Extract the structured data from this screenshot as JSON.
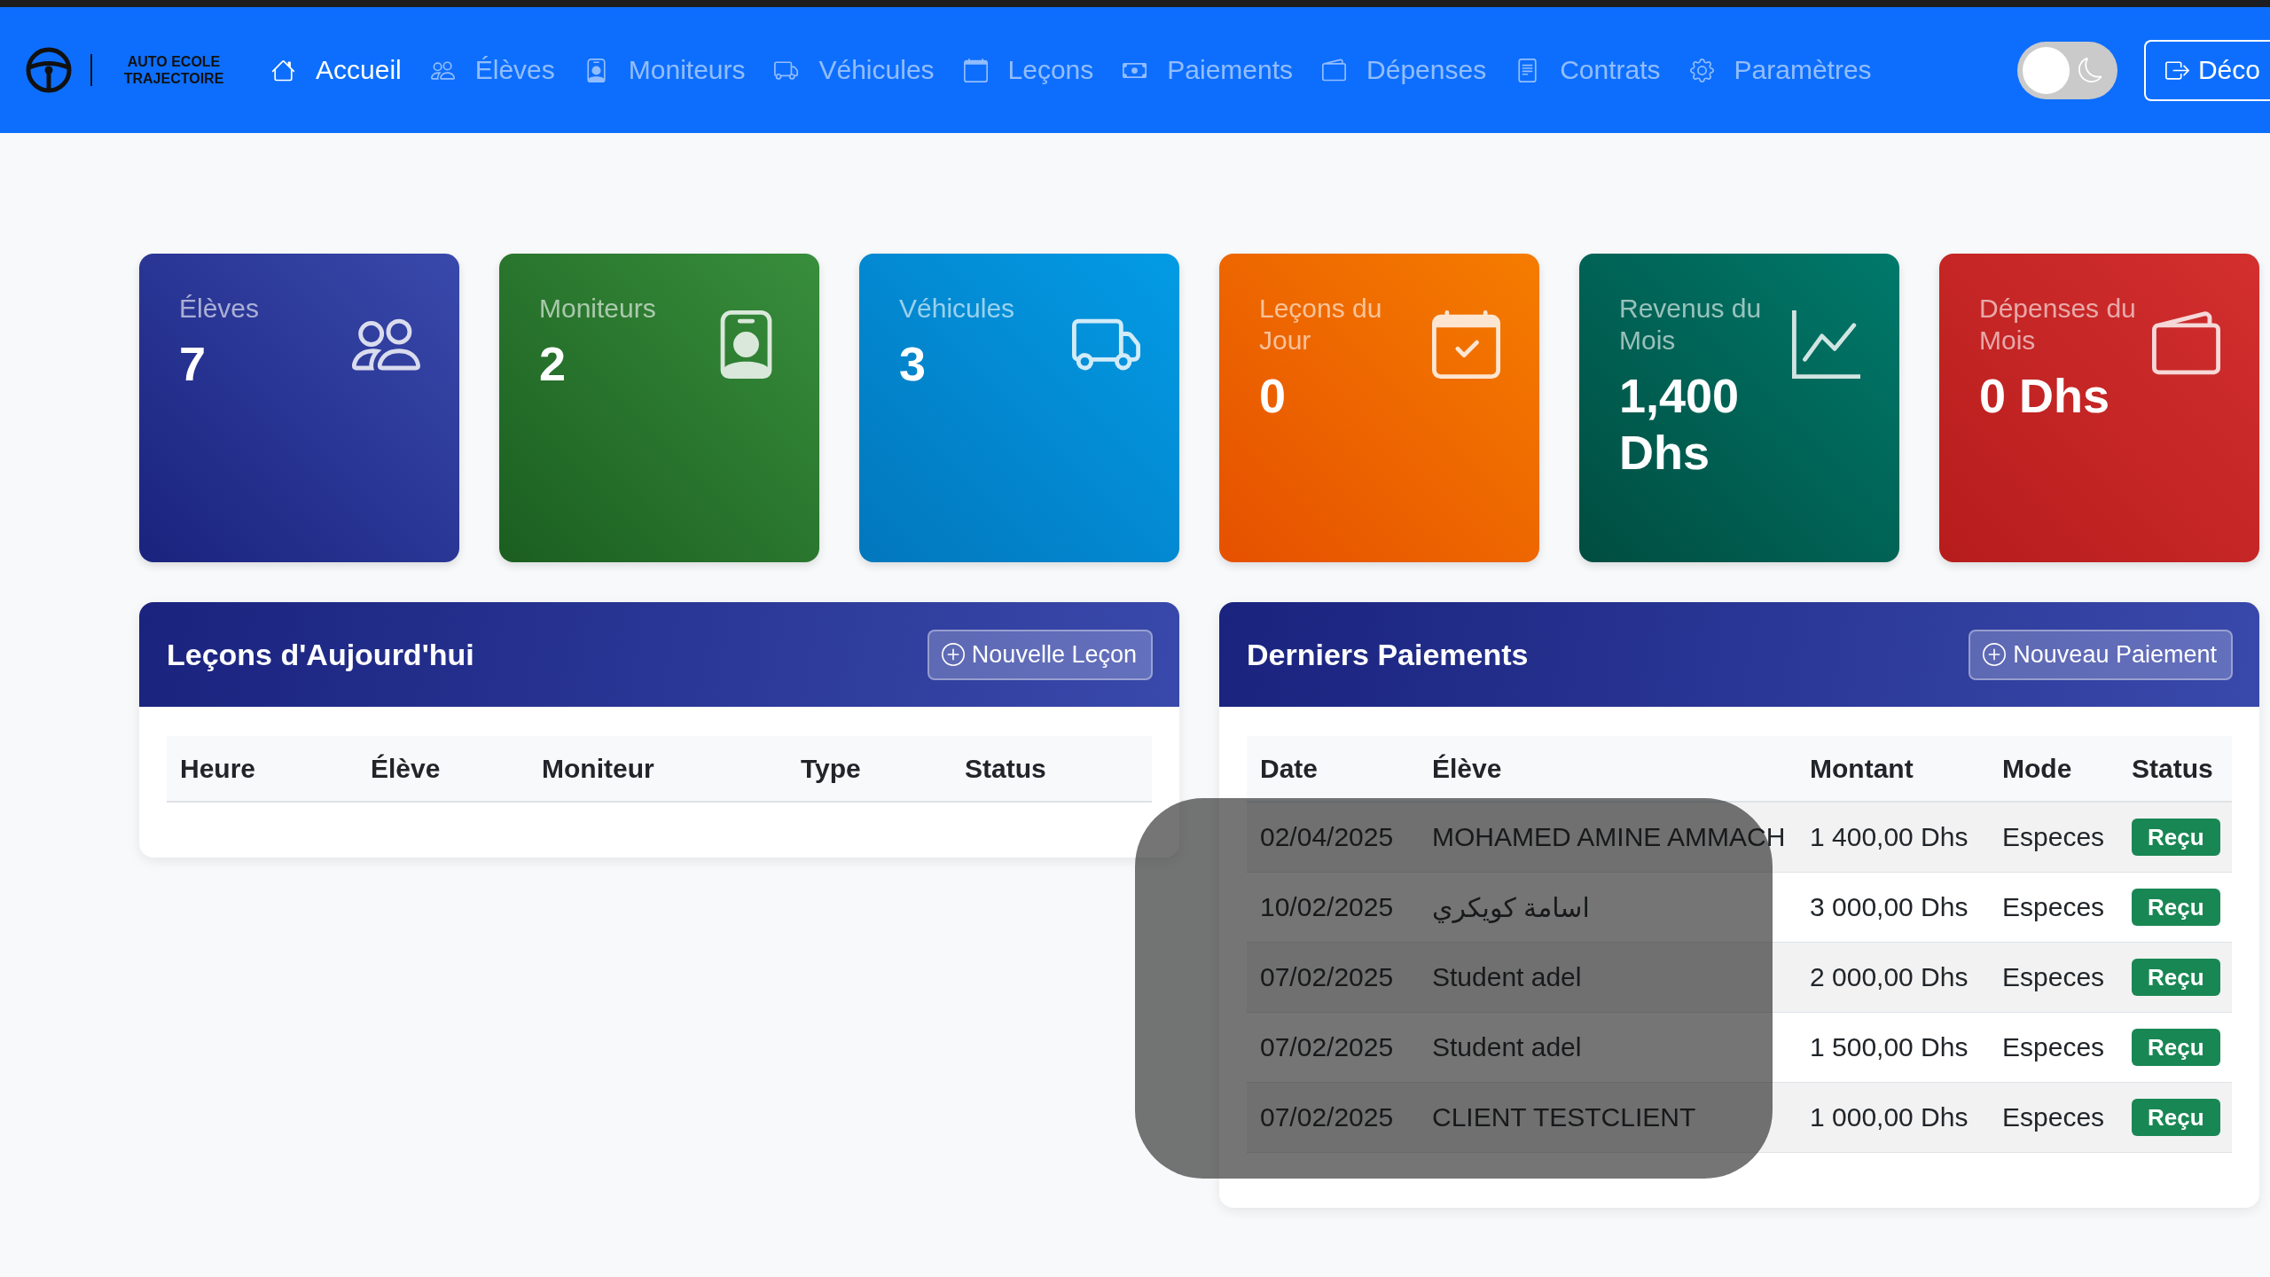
{
  "navbar": {
    "brand": "AUTO ECOLE TRAJECTOIRE",
    "items": [
      {
        "label": "Accueil",
        "kind": "home",
        "selected": true
      },
      {
        "label": "Élèves",
        "kind": "students",
        "selected": false
      },
      {
        "label": "Moniteurs",
        "kind": "instructors",
        "selected": false
      },
      {
        "label": "Véhicules",
        "kind": "vehicles",
        "selected": false
      },
      {
        "label": "Leçons",
        "kind": "lessons",
        "selected": false
      },
      {
        "label": "Paiements",
        "kind": "payments",
        "selected": false
      },
      {
        "label": "Dépenses",
        "kind": "expenses",
        "selected": false
      },
      {
        "label": "Contrats",
        "kind": "contracts",
        "selected": false
      },
      {
        "label": "Paramètres",
        "kind": "settings",
        "selected": false
      }
    ],
    "dark_mode_toggle": {
      "on": false
    },
    "logout_button": {
      "label": "Déco"
    }
  },
  "stat_cards": [
    {
      "label": "Élèves",
      "value": "7",
      "kind": "students"
    },
    {
      "label": "Moniteurs",
      "value": "2",
      "kind": "instructors"
    },
    {
      "label": "Véhicules",
      "value": "3",
      "kind": "vehicles"
    },
    {
      "label": "Leçons du Jour",
      "value": "0",
      "kind": "lessons"
    },
    {
      "label": "Revenus du Mois",
      "value": "1,400 Dhs",
      "kind": "revenue"
    },
    {
      "label": "Dépenses du Mois",
      "value": "0 Dhs",
      "kind": "expenses"
    }
  ],
  "todays_lessons": {
    "title": "Leçons d'Aujourd'hui",
    "button": "Nouvelle Leçon",
    "table": {
      "columns": [
        "Heure",
        "Élève",
        "Moniteur",
        "Type",
        "Status"
      ]
    }
  },
  "recent_payments": {
    "title": "Derniers Paiements",
    "button": "Nouveau Paiement",
    "table": {
      "columns": [
        "Date",
        "Élève",
        "Montant",
        "Mode",
        "Status"
      ],
      "rows": [
        {
          "date": "02/04/2025",
          "student": "MOHAMED AMINE AMMACH",
          "amount": "1 400,00 Dhs",
          "mode": "Especes",
          "status": "Reçu"
        },
        {
          "date": "10/02/2025",
          "student": "اسامة كويكري",
          "amount": "3 000,00 Dhs",
          "mode": "Especes",
          "status": "Reçu"
        },
        {
          "date": "07/02/2025",
          "student": "Student adel",
          "amount": "2 000,00 Dhs",
          "mode": "Especes",
          "status": "Reçu"
        },
        {
          "date": "07/02/2025",
          "student": "Student adel",
          "amount": "1 500,00 Dhs",
          "mode": "Especes",
          "status": "Reçu"
        },
        {
          "date": "07/02/2025",
          "student": "CLIENT TESTCLIENT",
          "amount": "1 000,00 Dhs",
          "mode": "Especes",
          "status": "Reçu"
        }
      ]
    }
  }
}
